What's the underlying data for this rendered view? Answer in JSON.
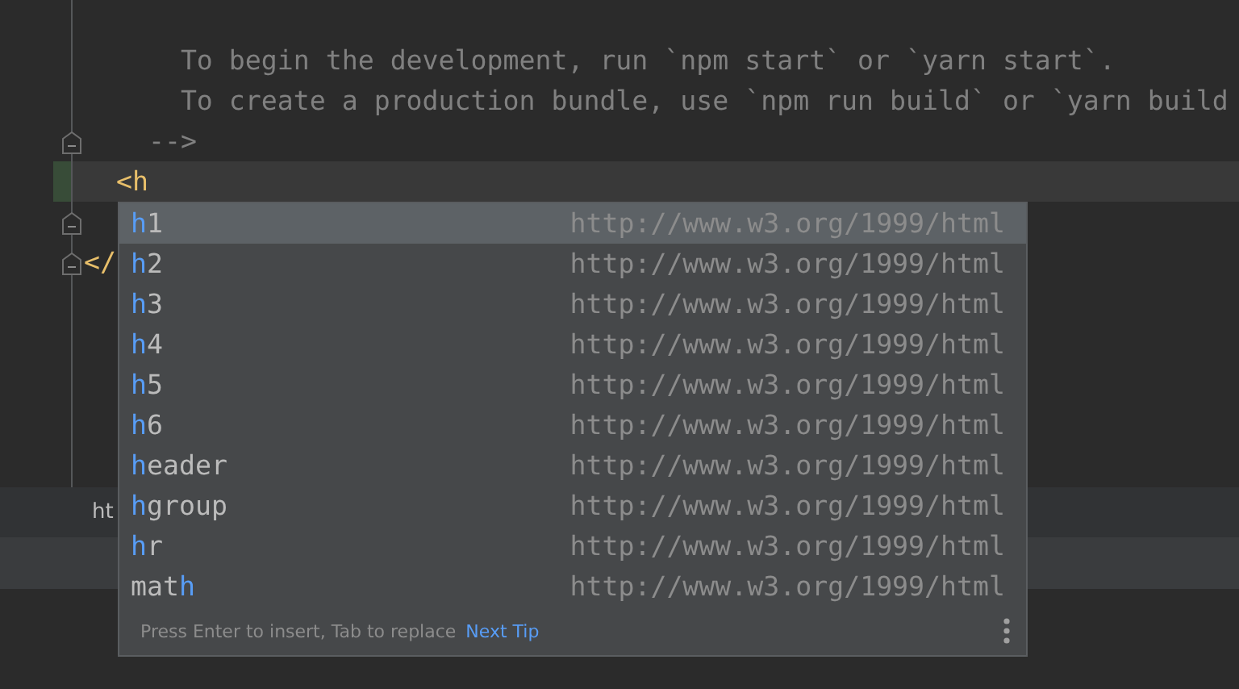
{
  "editor": {
    "lines": [
      {
        "current": false,
        "changed": false,
        "fold": false
      },
      {
        "text": "      To begin the development, run `npm start` or `yarn start`.",
        "kind": "comment",
        "current": false,
        "changed": false,
        "fold": false
      },
      {
        "text": "      To create a production bundle, use `npm run build` or `yarn build",
        "kind": "comment",
        "current": false,
        "changed": false,
        "fold": false
      },
      {
        "text": "    -->",
        "kind": "comment",
        "current": false,
        "changed": false,
        "fold": true
      },
      {
        "text": "  <h",
        "kind": "tag",
        "current": true,
        "changed": true,
        "fold": false
      },
      {
        "current": false,
        "changed": false,
        "fold": true
      },
      {
        "text": "</",
        "kind": "tag",
        "current": false,
        "changed": false,
        "fold": true
      }
    ]
  },
  "breadcrumb": "ht",
  "completion": {
    "items": [
      {
        "parts": [
          {
            "text": "h",
            "match": true
          },
          {
            "text": "1",
            "match": false
          }
        ],
        "namespace": "http://www.w3.org/1999/html",
        "selected": true
      },
      {
        "parts": [
          {
            "text": "h",
            "match": true
          },
          {
            "text": "2",
            "match": false
          }
        ],
        "namespace": "http://www.w3.org/1999/html",
        "selected": false
      },
      {
        "parts": [
          {
            "text": "h",
            "match": true
          },
          {
            "text": "3",
            "match": false
          }
        ],
        "namespace": "http://www.w3.org/1999/html",
        "selected": false
      },
      {
        "parts": [
          {
            "text": "h",
            "match": true
          },
          {
            "text": "4",
            "match": false
          }
        ],
        "namespace": "http://www.w3.org/1999/html",
        "selected": false
      },
      {
        "parts": [
          {
            "text": "h",
            "match": true
          },
          {
            "text": "5",
            "match": false
          }
        ],
        "namespace": "http://www.w3.org/1999/html",
        "selected": false
      },
      {
        "parts": [
          {
            "text": "h",
            "match": true
          },
          {
            "text": "6",
            "match": false
          }
        ],
        "namespace": "http://www.w3.org/1999/html",
        "selected": false
      },
      {
        "parts": [
          {
            "text": "h",
            "match": true
          },
          {
            "text": "eader",
            "match": false
          }
        ],
        "namespace": "http://www.w3.org/1999/html",
        "selected": false
      },
      {
        "parts": [
          {
            "text": "h",
            "match": true
          },
          {
            "text": "group",
            "match": false
          }
        ],
        "namespace": "http://www.w3.org/1999/html",
        "selected": false
      },
      {
        "parts": [
          {
            "text": "h",
            "match": true
          },
          {
            "text": "r",
            "match": false
          }
        ],
        "namespace": "http://www.w3.org/1999/html",
        "selected": false
      },
      {
        "parts": [
          {
            "text": "mat",
            "match": false
          },
          {
            "text": "h",
            "match": true
          }
        ],
        "namespace": "http://www.w3.org/1999/html",
        "selected": false
      }
    ],
    "hint": "Press Enter to insert, Tab to replace",
    "link": "Next Tip"
  }
}
